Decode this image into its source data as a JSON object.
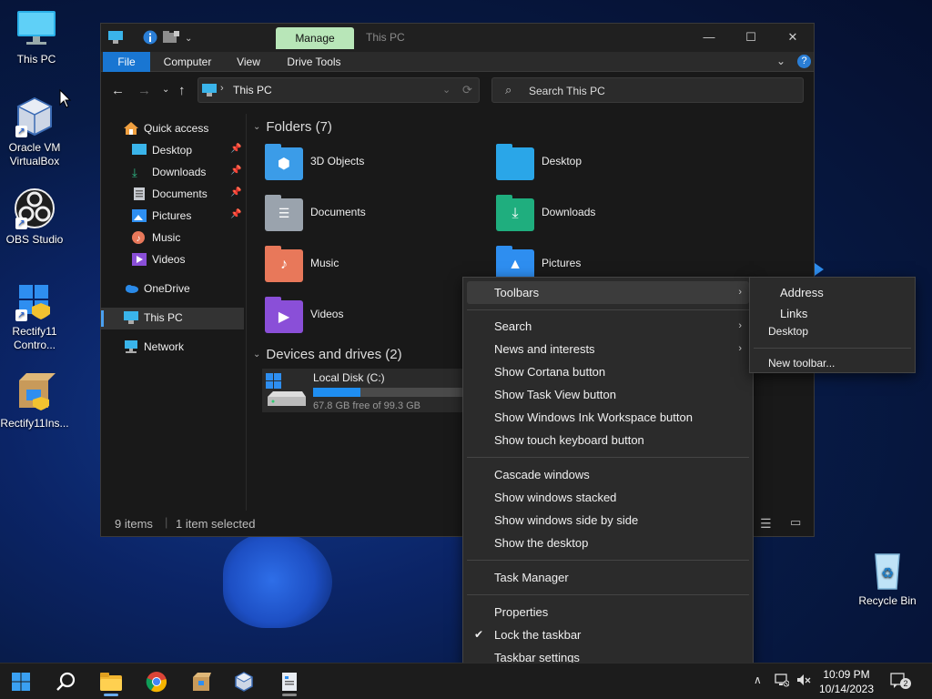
{
  "desktop": {
    "icons": [
      {
        "label": "This PC"
      },
      {
        "label": "Oracle VM VirtualBox"
      },
      {
        "label": "OBS Studio"
      },
      {
        "label": "Rectify11 Contro..."
      },
      {
        "label": "Rectify11Ins..."
      },
      {
        "label": "Recycle Bin"
      }
    ]
  },
  "window": {
    "manage_tab": "Manage",
    "title": "This PC",
    "ribbon_tabs": [
      "File",
      "Computer",
      "View",
      "Drive Tools"
    ],
    "address": "This PC",
    "search_placeholder": "Search This PC",
    "sidebar": {
      "quick_access": "Quick access",
      "items": [
        "Desktop",
        "Downloads",
        "Documents",
        "Pictures",
        "Music",
        "Videos"
      ],
      "onedrive": "OneDrive",
      "this_pc": "This PC",
      "network": "Network"
    },
    "folders_header": "Folders (7)",
    "folders": [
      "3D Objects",
      "Desktop",
      "Documents",
      "Downloads",
      "Music",
      "Pictures",
      "Videos"
    ],
    "devices_header": "Devices and drives (2)",
    "drive": {
      "name": "Local Disk (C:)",
      "free": "67.8 GB free of 99.3 GB",
      "used_fraction": 0.317
    },
    "status": {
      "items": "9 items",
      "selected": "1 item selected"
    }
  },
  "context_menu": {
    "items": [
      "Toolbars",
      "Search",
      "News and interests",
      "Show Cortana button",
      "Show Task View button",
      "Show Windows Ink Workspace button",
      "Show touch keyboard button",
      "Cascade windows",
      "Show windows stacked",
      "Show windows side by side",
      "Show the desktop",
      "Task Manager",
      "Properties",
      "Lock the taskbar",
      "Taskbar settings"
    ]
  },
  "toolbars_submenu": {
    "items": [
      "Address",
      "Links",
      "Desktop",
      "New toolbar..."
    ]
  },
  "taskbar": {
    "time": "10:09 PM",
    "date": "10/14/2023",
    "notification_count": "2"
  },
  "colors": {
    "accent": "#1976d2",
    "manage_tab": "#b8e6b8",
    "progress": "#1f8ef1"
  }
}
